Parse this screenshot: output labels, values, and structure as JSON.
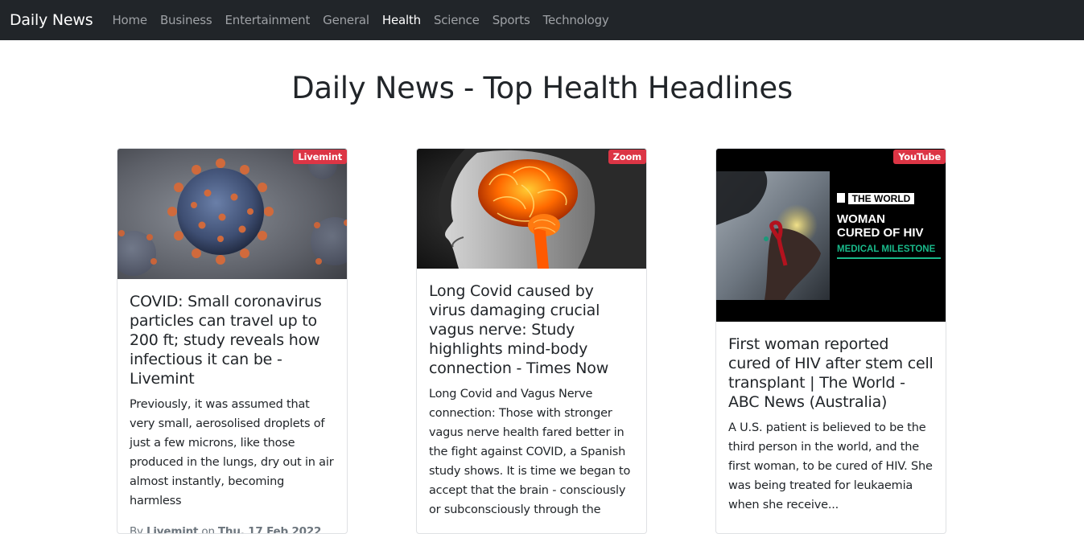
{
  "navbar": {
    "brand": "Daily News",
    "links": [
      {
        "label": "Home",
        "active": false
      },
      {
        "label": "Business",
        "active": false
      },
      {
        "label": "Entertainment",
        "active": false
      },
      {
        "label": "General",
        "active": false
      },
      {
        "label": "Health",
        "active": true
      },
      {
        "label": "Science",
        "active": false
      },
      {
        "label": "Sports",
        "active": false
      },
      {
        "label": "Technology",
        "active": false
      }
    ]
  },
  "page": {
    "title": "Daily News - Top Health Headlines"
  },
  "cards": [
    {
      "source": "Livemint",
      "title": "COVID: Small coronavirus particles can travel up to 200 ft; study reveals how infectious it can be - Livemint",
      "description": "Previously, it was assumed that very small, aerosolised droplets of just a few microns, like those produced in the lungs, dry out in air almost instantly, becoming harmless",
      "byline_by": "By",
      "author": "Livemint",
      "byline_on": "on",
      "date": "Thu, 17 Feb 2022"
    },
    {
      "source": "Zoom",
      "title": "Long Covid caused by virus damaging crucial vagus nerve: Study highlights mind-body connection - Times Now",
      "description": "Long Covid and Vagus Nerve connection: Those with stronger vagus nerve health fared better in the fight against COVID, a Spanish study shows. It is time we began to accept that the brain - consciously or subconsciously through the"
    },
    {
      "source": "YouTube",
      "title": "First woman reported cured of HIV after stem cell transplant | The World - ABC News (Australia)",
      "description": "A U.S. patient is believed to be the third person in the world, and the first woman, to be cured of HIV. She was being treated for leukaemia when she receive...",
      "thumbnail": {
        "show_name": "THE WORLD",
        "headline": "WOMAN CURED OF HIV",
        "subhead": "MEDICAL MILESTONE"
      }
    }
  ],
  "colors": {
    "navbar_bg": "#212529",
    "badge_bg": "#dc3545",
    "thumbnail_accent": "#19b98a"
  }
}
